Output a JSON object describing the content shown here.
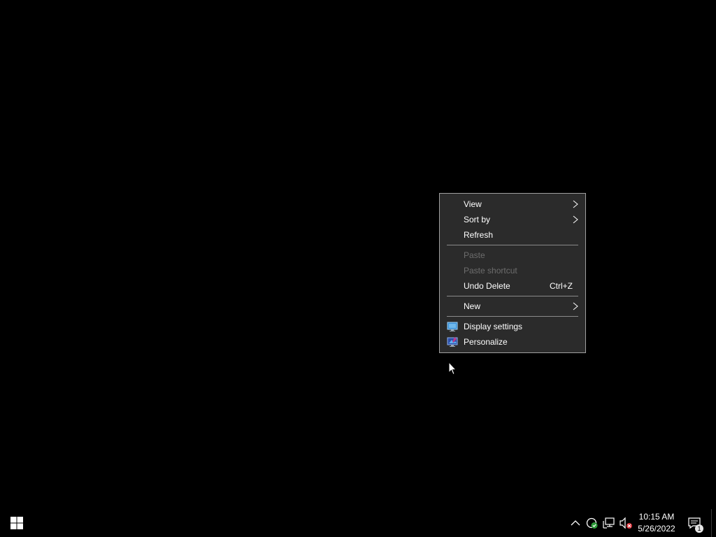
{
  "context_menu": {
    "items": [
      {
        "label": "View",
        "submenu": true,
        "enabled": true
      },
      {
        "label": "Sort by",
        "submenu": true,
        "enabled": true
      },
      {
        "label": "Refresh",
        "enabled": true
      },
      {
        "label": "Paste",
        "enabled": false
      },
      {
        "label": "Paste shortcut",
        "enabled": false
      },
      {
        "label": "Undo Delete",
        "shortcut": "Ctrl+Z",
        "enabled": true
      },
      {
        "label": "New",
        "submenu": true,
        "enabled": true
      },
      {
        "label": "Display settings",
        "icon": "display-icon",
        "enabled": true
      },
      {
        "label": "Personalize",
        "icon": "personalize-icon",
        "enabled": true
      }
    ]
  },
  "taskbar": {
    "start_icon": "windows-logo-icon",
    "tray_icons": [
      "chevron-up-icon",
      "security-icon",
      "network-icon",
      "volume-muted-icon"
    ],
    "clock": {
      "time": "10:15 AM",
      "date": "5/26/2022"
    },
    "notification_count": "1"
  },
  "colors": {
    "desktop": "#000000",
    "menu_bg": "#2b2b2b",
    "menu_text": "#ffffff",
    "menu_disabled": "#6d6d6d"
  }
}
